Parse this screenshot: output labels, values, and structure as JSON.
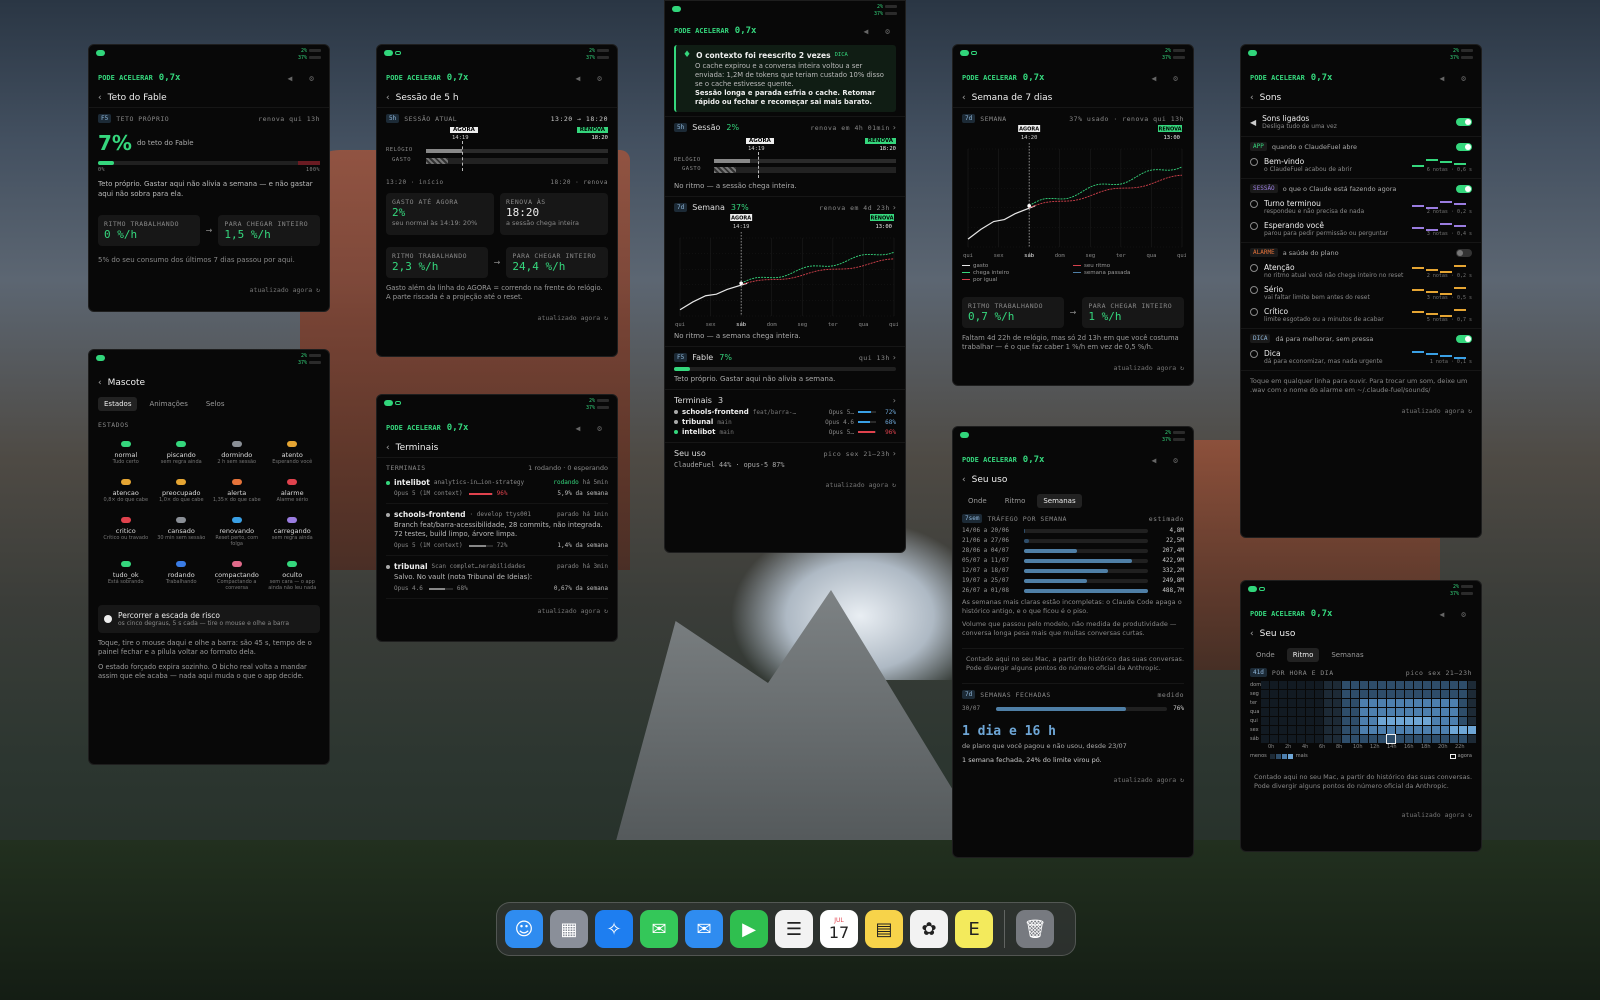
{
  "common": {
    "accel_label": "PODE ACELERAR",
    "accel_value": "0,7x",
    "meter_top": "2%",
    "meter_bottom": "37%",
    "updated": "atualizado agora"
  },
  "fable": {
    "title": "Teto do Fable",
    "tag": "F5",
    "cap": "TETO PRÓPRIO",
    "renew": "renova qui 13h",
    "pct": "7%",
    "of": "do teto do Fable",
    "fill": 0.07,
    "scale_min": "0%",
    "scale_max": "100%",
    "desc": "Teto próprio. Gastar aqui não alivia a semana — e não gastar aqui não sobra para ela.",
    "rate_label": "RITMO TRABALHANDO",
    "rate_value": "0 %/h",
    "need_label": "PARA CHEGAR INTEIRO",
    "need_value": "1,5 %/h",
    "note": "5% do seu consumo dos últimos 7 dias passou por aqui."
  },
  "sessao5": {
    "title": "Sessão de 5 h",
    "tag": "5h",
    "cap": "SESSÃO ATUAL",
    "range": "13:20 → 18:20",
    "now": "AGORA",
    "now_time": "14:19",
    "renew_badge": "RENOVA",
    "renew_time": "18:20",
    "clock": "RELÓGIO",
    "spent": "GASTO",
    "start": "13:20 · início",
    "end": "18:20 · renova",
    "spent_label": "GASTO ATÉ AGORA",
    "spent_value": "2%",
    "spent_sub": "seu normal às 14:19: 20%",
    "renew_label": "RENOVA ÀS",
    "renew_value": "18:20",
    "renew_sub": "a sessão chega inteira",
    "rate_label": "RITMO TRABALHANDO",
    "rate_value": "2,3 %/h",
    "need_label": "PARA CHEGAR INTEIRO",
    "need_value": "24,4 %/h",
    "note": "Gasto além da linha do AGORA = correndo na frente do relógio. A parte riscada é a projeção até o reset."
  },
  "mascote": {
    "title": "Mascote",
    "tabs": [
      "Estados",
      "Animações",
      "Selos"
    ],
    "cap": "ESTADOS",
    "states": [
      {
        "name": "normal",
        "sub": "Tudo certo",
        "color": "#35d77d"
      },
      {
        "name": "piscando",
        "sub": "sem regra ainda",
        "color": "#35d77d"
      },
      {
        "name": "dormindo",
        "sub": "2 h sem sessão",
        "color": "#8a8f96"
      },
      {
        "name": "atento",
        "sub": "Esperando você",
        "color": "#e5a533"
      },
      {
        "name": "atencao",
        "sub": "0,8× do que cabe",
        "color": "#e5a533"
      },
      {
        "name": "preocupado",
        "sub": "1,0× do que cabe",
        "color": "#e5a533"
      },
      {
        "name": "alerta",
        "sub": "1,35× do que cabe",
        "color": "#e5733a"
      },
      {
        "name": "alarme",
        "sub": "Alarme sério",
        "color": "#e0424d"
      },
      {
        "name": "critico",
        "sub": "Crítico ou travado",
        "color": "#e0424d"
      },
      {
        "name": "cansado",
        "sub": "30 min sem sessão",
        "color": "#8a8f96"
      },
      {
        "name": "renovando",
        "sub": "Reset perto, com folga",
        "color": "#3aa0e5"
      },
      {
        "name": "carregando",
        "sub": "sem regra ainda",
        "color": "#9a7ce0"
      },
      {
        "name": "tudo_ok",
        "sub": "Está sobrando",
        "color": "#35d77d"
      },
      {
        "name": "rodando",
        "sub": "Trabalhando",
        "color": "#3a7ce5"
      },
      {
        "name": "compactando",
        "sub": "Compactando a conversa",
        "color": "#e06a8a"
      },
      {
        "name": "oculto",
        "sub": "sem cara — o app ainda não leu nada",
        "color": "#35d77d"
      }
    ],
    "ladder_title": "Percorrer a escada de risco",
    "ladder_sub": "os cinco degraus, 5 s cada — tire o mouse e olhe a barra",
    "note1": "Toque, tire o mouse daqui e olhe a barra: são 45 s, tempo de o painel fechar e a pílula voltar ao formato dela.",
    "note2": "O estado forçado expira sozinho. O bicho real volta a mandar assim que ele acaba — nada aqui muda o que o app decide."
  },
  "terminais": {
    "title": "Terminais",
    "cap": "TERMINAIS",
    "summary": "1 rodando · 0 esperando",
    "items": [
      {
        "name": "intelibot",
        "detail": "analytics-in…ion-strategy",
        "status": "rodando",
        "since": "há 5min",
        "model": "Opus 5 (1M context)",
        "pct": "96%",
        "week": "5,9% da semana",
        "text": "",
        "dot": "#35d77d",
        "bar": "#e0424d",
        "fill": 0.96
      },
      {
        "name": "schools-frontend",
        "detail": "· develop ttys001",
        "status": "parado",
        "since": "há 1min",
        "model": "Opus 5 (1M context)",
        "pct": "72%",
        "week": "1,4% da semana",
        "text": "Branch feat/barra-acessibilidade, 28 commits, não integrada. 72 testes, build limpo, árvore limpa.",
        "dot": "#aaa",
        "bar": "#888",
        "fill": 0.72
      },
      {
        "name": "tribunal",
        "detail": "Scan complet…nerabilidades",
        "status": "parado",
        "since": "há 3min",
        "model": "Opus 4.6",
        "pct": "68%",
        "week": "0,67% da semana",
        "text": "Salvo. No vault (nota Tribunal de Ideias):",
        "dot": "#aaa",
        "bar": "#888",
        "fill": 0.68
      }
    ]
  },
  "central": {
    "tip_title": "O contexto foi reescrito 2 vezes",
    "tip_tag": "DICA",
    "tip_body": "O cache expirou e a conversa inteira voltou a ser enviada: 1,2M de tokens que teriam custado 10% disso se o cache estivesse quente.",
    "tip_bold": "Sessão longa e parada esfria o cache. Retomar rápido ou fechar e recomeçar sai mais barato.",
    "s_tag": "5h",
    "s_label": "Sessão",
    "s_pct": "2%",
    "s_renew": "renova em 4h 01min",
    "now": "AGORA",
    "now_time": "14:19",
    "renew_badge": "RENOVA",
    "s_renew_time": "18:20",
    "clock": "RELÓGIO",
    "spent": "GASTO",
    "s_note": "No ritmo — a sessão chega inteira.",
    "w_tag": "7d",
    "w_label": "Semana",
    "w_pct": "37%",
    "w_renew": "renova em 4d 23h",
    "w_renew_time": "13:00",
    "w_note": "No ritmo — a semana chega inteira.",
    "f_tag": "F5",
    "f_label": "Fable",
    "f_pct": "7%",
    "f_renew": "qui 13h",
    "f_note": "Teto próprio. Gastar aqui não alivia a semana.",
    "t_label": "Terminais",
    "t_count": "3",
    "terms": [
      {
        "name": "schools-frontend",
        "branch": "feat/barra-…",
        "model": "Opus 5…",
        "pct": "72%",
        "color": "#3aa0e5",
        "fill": 0.72
      },
      {
        "name": "tribunal",
        "branch": "main",
        "model": "Opus 4.6",
        "pct": "68%",
        "color": "#3aa0e5",
        "fill": 0.68
      },
      {
        "name": "intelibot",
        "branch": "main",
        "model": "Opus 5…",
        "pct": "96%",
        "color": "#e0424d",
        "fill": 0.96
      }
    ],
    "u_label": "Seu uso",
    "u_peak": "pico sex 21–23h",
    "u_line": "ClaudeFuel 44% · opus-5 87%"
  },
  "semana": {
    "title": "Semana de 7 dias",
    "tag": "7d",
    "cap": "SEMANA",
    "status": "37% usado · renova qui 13h",
    "now": "AGORA",
    "now_time": "14:20",
    "renew_badge": "RENOVA",
    "renew_time": "13:00",
    "days": [
      "qui",
      "sex",
      "sáb",
      "dom",
      "seg",
      "ter",
      "qua",
      "qui"
    ],
    "legend": [
      "gasto",
      "seu ritmo",
      "chega inteiro",
      "semana passada",
      "por igual"
    ],
    "rate_label": "RITMO TRABALHANDO",
    "rate_value": "0,7 %/h",
    "need_label": "PARA CHEGAR INTEIRO",
    "need_value": "1 %/h",
    "note": "Faltam 4d 22h de relógio, mas só 2d 13h em que você costuma trabalhar — é o que faz caber 1 %/h em vez de 0,5 %/h."
  },
  "sons": {
    "title": "Sons",
    "master": "Sons ligados",
    "master_sub": "Desliga tudo de uma vez",
    "groups": [
      {
        "tag": "APP",
        "tagc": "#35d77d",
        "label": "quando o ClaudeFuel abre",
        "on": true,
        "items": [
          {
            "n": "Bem-vindo",
            "s": "o ClaudeFuel acabou de abrir",
            "m": "6 notas · 0,6 s",
            "c": "#35d77d"
          }
        ]
      },
      {
        "tag": "SESSÃO",
        "tagc": "#9a7ce0",
        "label": "o que o Claude está fazendo agora",
        "on": true,
        "items": [
          {
            "n": "Turno terminou",
            "s": "respondeu e não precisa de nada",
            "m": "2 notas · 0,2 s",
            "c": "#9a7ce0"
          },
          {
            "n": "Esperando você",
            "s": "parou para pedir permissão ou perguntar",
            "m": "3 notas · 0,4 s",
            "c": "#9a7ce0"
          }
        ]
      },
      {
        "tag": "ALARME",
        "tagc": "#e5733a",
        "label": "a saúde do plano",
        "on": false,
        "items": [
          {
            "n": "Atenção",
            "s": "no ritmo atual você não chega inteiro no reset",
            "m": "2 notas · 0,2 s",
            "c": "#e5a533"
          },
          {
            "n": "Sério",
            "s": "vai faltar limite bem antes do reset",
            "m": "3 notas · 0,5 s",
            "c": "#e5a533"
          },
          {
            "n": "Crítico",
            "s": "limite esgotado ou a minutos de acabar",
            "m": "5 notas · 0,7 s",
            "c": "#e5a533"
          }
        ]
      },
      {
        "tag": "DICA",
        "tagc": "#8fb6d9",
        "label": "dá para melhorar, sem pressa",
        "on": true,
        "items": [
          {
            "n": "Dica",
            "s": "dá para economizar, mas nada urgente",
            "m": "1 nota · 0,1 s",
            "c": "#3aa0e5"
          }
        ]
      }
    ],
    "note": "Toque em qualquer linha para ouvir. Para trocar um som, deixe um .wav com o nome do alarme em ~/.claude-fuel/sounds/"
  },
  "uso_sem": {
    "title": "Seu uso",
    "tabs": [
      "Onde",
      "Ritmo",
      "Semanas"
    ],
    "tag": "7sem",
    "cap": "TRÁFEGO POR SEMANA",
    "est": "estimado",
    "rows": [
      {
        "w": "14/06 a 20/06",
        "v": "4,8M",
        "f": 0.01
      },
      {
        "w": "21/06 a 27/06",
        "v": "22,5M",
        "f": 0.04
      },
      {
        "w": "28/06 a 04/07",
        "v": "207,4M",
        "f": 0.43
      },
      {
        "w": "05/07 a 11/07",
        "v": "422,9M",
        "f": 0.87
      },
      {
        "w": "12/07 a 18/07",
        "v": "332,2M",
        "f": 0.68
      },
      {
        "w": "19/07 a 25/07",
        "v": "249,8M",
        "f": 0.51
      },
      {
        "w": "26/07 a 01/08",
        "v": "488,7M",
        "f": 1.0
      }
    ],
    "note1": "As semanas mais claras estão incompletas: o Claude Code apaga o histórico antigo, e o que ficou é o piso.",
    "note2": "Volume que passou pelo modelo, não medida de produtividade — conversa longa pesa mais que muitas conversas curtas.",
    "note3": "Contado aqui no seu Mac, a partir do histórico das suas conversas. Pode divergir alguns pontos do número oficial da Anthropic.",
    "c_tag": "7d",
    "c_cap": "SEMANAS FECHADAS",
    "c_med": "medido",
    "c_week": "30/07",
    "c_pct": "76%",
    "c_fill": 0.76,
    "big": "1 dia e 16 h",
    "big_sub": "de plano que você pagou e não usou, desde 23/07",
    "closed": "1 semana fechada, 24% do limite virou pó."
  },
  "uso_rit": {
    "title": "Seu uso",
    "tabs": [
      "Onde",
      "Ritmo",
      "Semanas"
    ],
    "tag": "41d",
    "cap": "POR HORA E DIA",
    "peak": "pico sex 21–23h",
    "days": [
      "dom",
      "seg",
      "ter",
      "qua",
      "qui",
      "sex",
      "sáb"
    ],
    "hours": [
      "0h",
      "2h",
      "4h",
      "6h",
      "8h",
      "10h",
      "12h",
      "14h",
      "16h",
      "18h",
      "20h",
      "22h"
    ],
    "less": "menos",
    "more": "mais",
    "now": "agora",
    "note": "Contado aqui no seu Mac, a partir do histórico das suas conversas. Pode divergir alguns pontos do número oficial da Anthropic."
  },
  "dock": {
    "items": [
      {
        "n": "finder-icon",
        "c": "#2f8cf0",
        "g": "☺"
      },
      {
        "n": "launchpad-icon",
        "c": "#8a8f99",
        "g": "▦"
      },
      {
        "n": "safari-icon",
        "c": "#1e7ef0",
        "g": "✧"
      },
      {
        "n": "messages-icon",
        "c": "#34c759",
        "g": "✉"
      },
      {
        "n": "mail-icon",
        "c": "#2f8cf0",
        "g": "✉"
      },
      {
        "n": "facetime-icon",
        "c": "#2fbf4f",
        "g": "▶"
      },
      {
        "n": "reminders-icon",
        "c": "#f2f2f2",
        "g": "☰"
      },
      {
        "n": "calendar-icon",
        "c": "#ffffff",
        "g": "17"
      },
      {
        "n": "notes-icon",
        "c": "#f7d34a",
        "g": "▤"
      },
      {
        "n": "photos-icon",
        "c": "#f2f2f2",
        "g": "✿"
      },
      {
        "n": "claudefuel-icon",
        "c": "#f3ea5c",
        "g": "E"
      },
      {
        "n": "trash-icon",
        "c": "#777a80",
        "g": "🗑"
      }
    ],
    "cal_month": "JUL"
  }
}
